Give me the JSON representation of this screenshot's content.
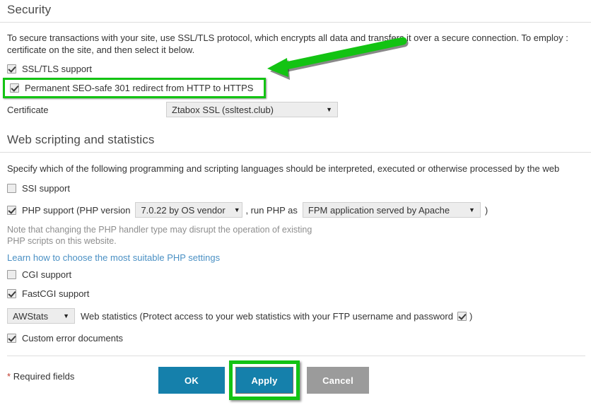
{
  "security": {
    "heading": "Security",
    "intro_line1": "To secure transactions with your site, use SSL/TLS protocol, which encrypts all data and transfers it over a secure connection. To employ :",
    "intro_line2": "certificate on the site, and then select it below.",
    "ssl_support_label": "SSL/TLS support",
    "ssl_support_checked": "checked",
    "seo_redirect_label": "Permanent SEO-safe 301 redirect from HTTP to HTTPS",
    "seo_redirect_checked": "checked",
    "certificate_label": "Certificate",
    "certificate_value": "Ztabox SSL (ssltest.club)",
    "dropdown_arrow": "▼"
  },
  "scripting": {
    "heading": "Web scripting and statistics",
    "intro": "Specify which of the following programming and scripting languages should be interpreted, executed or otherwise processed by the web",
    "ssi_label": "SSI support",
    "ssi_checked": "unchecked",
    "php_label_prefix": "PHP support (PHP version",
    "php_version_value": "7.0.22 by OS vendor",
    "php_middle_text": ", run PHP as",
    "php_handler_value": "FPM application served by Apache",
    "php_label_suffix": ")",
    "php_checked": "checked",
    "note_line1": "Note that changing the PHP handler type may disrupt the operation of existing",
    "note_line2": "PHP scripts on this website.",
    "learn_link": "Learn how to choose the most suitable PHP settings",
    "cgi_label": "CGI support",
    "cgi_checked": "unchecked",
    "fastcgi_label": "FastCGI support",
    "fastcgi_checked": "checked",
    "webstats_value": "AWStats",
    "webstats_text_before": "Web statistics (Protect access to your web statistics with your FTP username and password",
    "webstats_protect_checked": "checked",
    "webstats_text_after": ")",
    "custom_errors_label": "Custom error documents",
    "custom_errors_checked": "checked"
  },
  "footer": {
    "required_star": "*",
    "required_text": "Required fields",
    "ok_label": "OK",
    "apply_label": "Apply",
    "cancel_label": "Cancel"
  },
  "annotations": {
    "highlight_color": "#13c313",
    "arrow_color": "#13c313",
    "button_blue": "#1580ab",
    "button_gray": "#9b9b9b",
    "link_color": "#4a90c4"
  }
}
